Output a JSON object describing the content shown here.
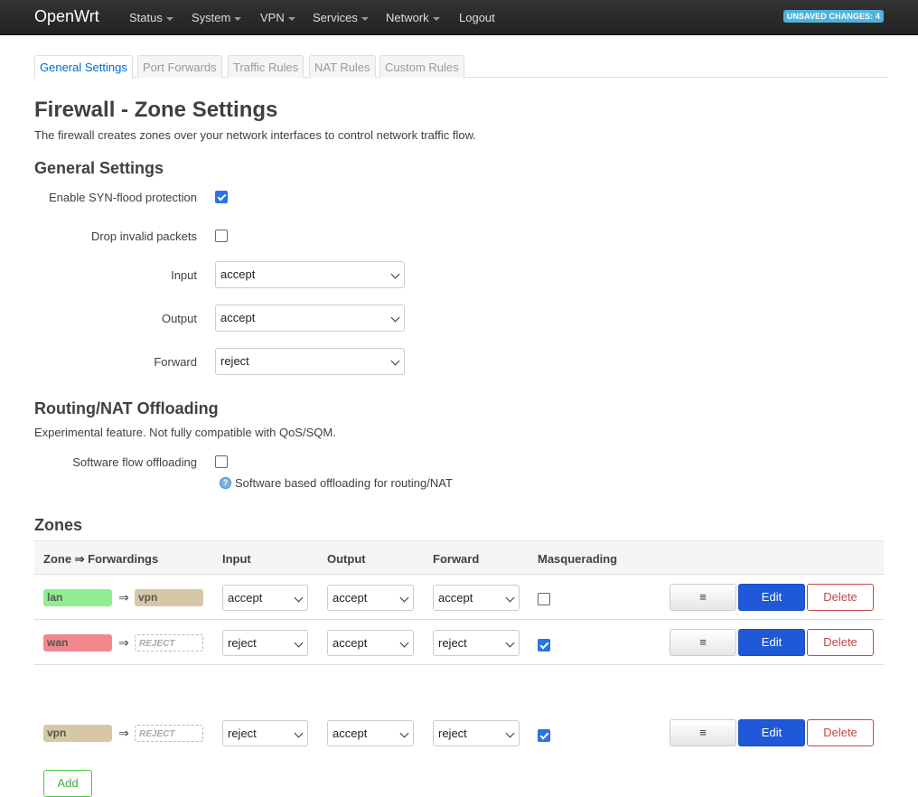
{
  "nav": {
    "brand": "OpenWrt",
    "items": [
      "Status",
      "System",
      "VPN",
      "Services",
      "Network"
    ],
    "logout": "Logout",
    "unsaved": "UNSAVED CHANGES: 4"
  },
  "tabs": [
    "General Settings",
    "Port Forwards",
    "Traffic Rules",
    "NAT Rules",
    "Custom Rules"
  ],
  "page": {
    "title": "Firewall - Zone Settings",
    "description": "The firewall creates zones over your network interfaces to control network traffic flow."
  },
  "general": {
    "title": "General Settings",
    "syn_flood_label": "Enable SYN-flood protection",
    "syn_flood_checked": true,
    "drop_invalid_label": "Drop invalid packets",
    "drop_invalid_checked": false,
    "input_label": "Input",
    "input_value": "accept",
    "output_label": "Output",
    "output_value": "accept",
    "forward_label": "Forward",
    "forward_value": "reject"
  },
  "offload": {
    "title": "Routing/NAT Offloading",
    "description": "Experimental feature. Not fully compatible with QoS/SQM.",
    "sw_label": "Software flow offloading",
    "sw_checked": false,
    "sw_help": "Software based offloading for routing/NAT"
  },
  "zones": {
    "title": "Zones",
    "headers": [
      "Zone ⇒ Forwardings",
      "Input",
      "Output",
      "Forward",
      "Masquerading"
    ],
    "arrow": "⇒",
    "rows": [
      {
        "zone": "lan",
        "zone_color": "#90ee90",
        "dest": "vpn",
        "dest_color": "#d6c8a6",
        "dest_reject": false,
        "input": "accept",
        "output": "accept",
        "forward": "accept",
        "masq": false
      },
      {
        "zone": "wan",
        "zone_color": "#f0888c",
        "dest": "REJECT",
        "dest_color": "#ffffff",
        "dest_reject": true,
        "input": "reject",
        "output": "accept",
        "forward": "reject",
        "masq": true
      },
      {
        "zone": "vpn",
        "zone_color": "#d6c8a6",
        "dest": "REJECT",
        "dest_color": "#ffffff",
        "dest_reject": true,
        "input": "reject",
        "output": "accept",
        "forward": "reject",
        "masq": true
      }
    ],
    "reorder_icon": "≡",
    "edit_label": "Edit",
    "delete_label": "Delete",
    "add_label": "Add"
  }
}
